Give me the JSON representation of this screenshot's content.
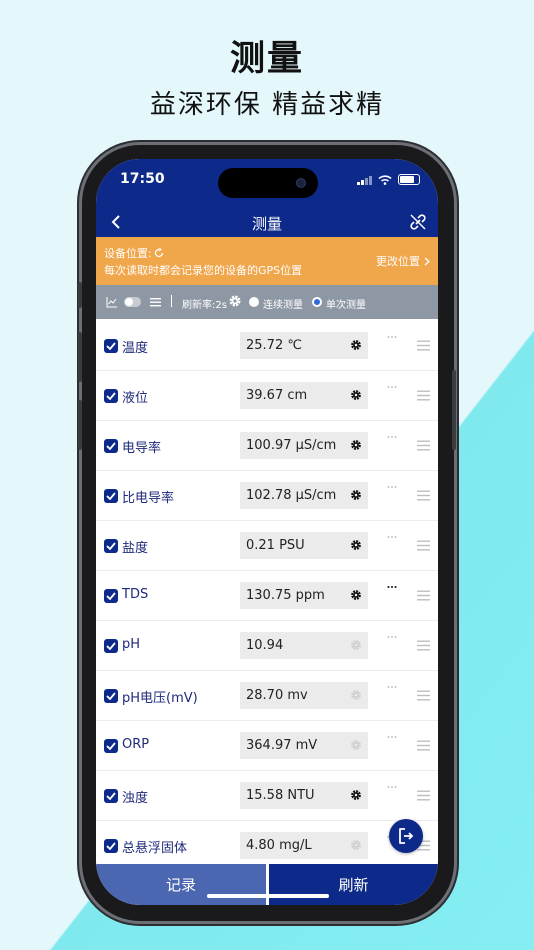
{
  "promo": {
    "title": "测量",
    "subtitle": "益深环保  精益求精"
  },
  "status_bar": {
    "time": "17:50"
  },
  "nav": {
    "title": "测量",
    "back_icon": "chevron-left-icon",
    "right_icon": "unlink-icon"
  },
  "location": {
    "label": "设备位置:",
    "description": "每次读取时都会记录您的设备的GPS位置",
    "change": "更改位置"
  },
  "toolbar": {
    "refresh_rate": "刷新率:2s",
    "continuous": "连续测量",
    "single": "单次测量",
    "selected_mode": "single"
  },
  "rows": [
    {
      "name": "温度",
      "value": "25.72 ℃",
      "checked": true,
      "gear_active": true,
      "more_active": false
    },
    {
      "name": "液位",
      "value": "39.67 cm",
      "checked": true,
      "gear_active": true,
      "more_active": false
    },
    {
      "name": "电导率",
      "value": "100.97 μS/cm",
      "checked": true,
      "gear_active": true,
      "more_active": false
    },
    {
      "name": "比电导率",
      "value": "102.78 μS/cm",
      "checked": true,
      "gear_active": true,
      "more_active": false
    },
    {
      "name": "盐度",
      "value": "0.21 PSU",
      "checked": true,
      "gear_active": true,
      "more_active": false
    },
    {
      "name": "TDS",
      "value": "130.75 ppm",
      "checked": true,
      "gear_active": true,
      "more_active": true
    },
    {
      "name": "pH",
      "value": "10.94",
      "checked": true,
      "gear_active": false,
      "more_active": false
    },
    {
      "name": "pH电压(mV)",
      "value": "28.70 mv",
      "checked": true,
      "gear_active": false,
      "more_active": false
    },
    {
      "name": "ORP",
      "value": "364.97 mV",
      "checked": true,
      "gear_active": false,
      "more_active": false
    },
    {
      "name": "浊度",
      "value": "15.58 NTU",
      "checked": true,
      "gear_active": true,
      "more_active": false
    },
    {
      "name": "总悬浮固体",
      "value": "4.80 mg/L",
      "checked": true,
      "gear_active": false,
      "more_active": false
    }
  ],
  "bottom": {
    "record": "记录",
    "refresh": "刷新"
  },
  "colors": {
    "primary": "#0d2a8a",
    "banner": "#f0a64b",
    "toolbar": "#8e98a5",
    "record_button": "#4c67b1",
    "background_cyan": "#86eef2"
  }
}
